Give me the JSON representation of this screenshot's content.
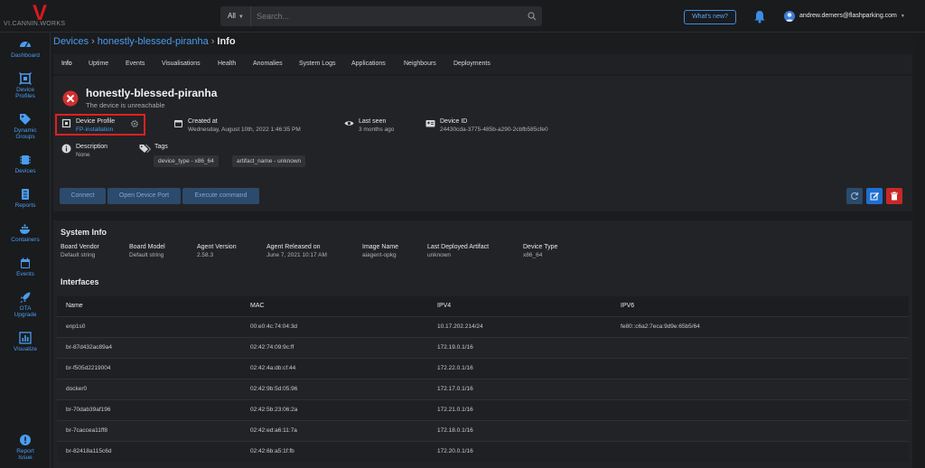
{
  "header": {
    "logo_mark": "V",
    "logo_text": "VI.CANNIN.WORKS",
    "search_scope": "All",
    "search_placeholder": "Search...",
    "whats_new": "What's new?",
    "user_email": "andrew.demers@flashparking.com"
  },
  "sidebar": {
    "items": [
      {
        "label": "Dashboard",
        "icon": "dashboard-icon"
      },
      {
        "label": "Device Profiles",
        "icon": "device-profile-icon"
      },
      {
        "label": "Dynamic Groups",
        "icon": "tags-icon"
      },
      {
        "label": "Devices",
        "icon": "chip-icon"
      },
      {
        "label": "Reports",
        "icon": "report-icon"
      },
      {
        "label": "Containers",
        "icon": "docker-icon"
      },
      {
        "label": "Events",
        "icon": "calendar-icon"
      },
      {
        "label": "OTA Upgrade",
        "icon": "rocket-icon"
      },
      {
        "label": "Visualize",
        "icon": "chart-icon"
      }
    ],
    "report_issue": "Report Issue"
  },
  "breadcrumb": {
    "root": "Devices",
    "device": "honestly-blessed-piranha",
    "current": "Info"
  },
  "tabs": [
    "Info",
    "Uptime",
    "Events",
    "Visualisations",
    "Health",
    "Anomalies",
    "System Logs",
    "Applications",
    "Neighbours",
    "Deployments"
  ],
  "device": {
    "name": "honestly-blessed-piranha",
    "status": "The device is unreachable",
    "profile_label": "Device Profile",
    "profile_value": "FP-installation",
    "created_label": "Created at",
    "created_value": "Wednesday, August 10th, 2022 1:46:35 PM",
    "lastseen_label": "Last seen",
    "lastseen_value": "3 months ago",
    "id_label": "Device ID",
    "id_value": "24430cda-3775-485b-a290-2cbfb585cfe0",
    "description_label": "Description",
    "description_value": "None",
    "tags_label": "Tags",
    "tags": [
      "device_type - x86_64",
      "artifact_name - unknown"
    ]
  },
  "actions": {
    "connect": "Connect",
    "open_port": "Open Device Port",
    "execute": "Execute command"
  },
  "system_info": {
    "title": "System Info",
    "fields": [
      {
        "label": "Board Vendor",
        "value": "Default string"
      },
      {
        "label": "Board Model",
        "value": "Default string"
      },
      {
        "label": "Agent Version",
        "value": "2.58.3"
      },
      {
        "label": "Agent Released on",
        "value": "June 7, 2021 10:17 AM"
      },
      {
        "label": "Image Name",
        "value": "aiagent-opkg"
      },
      {
        "label": "Last Deployed Artifact",
        "value": "unknown"
      },
      {
        "label": "Device Type",
        "value": "x86_64"
      }
    ]
  },
  "interfaces": {
    "title": "Interfaces",
    "columns": [
      "Name",
      "MAC",
      "IPV4",
      "IPV6"
    ],
    "rows": [
      [
        "enp1s0",
        "00:e0:4c:74:04:3d",
        "10.17.202.214/24",
        "fe80::c6a2:7eca:9d9e:65b5/64"
      ],
      [
        "br-87d432ac89a4",
        "02:42:74:09:9c:ff",
        "172.19.0.1/16",
        ""
      ],
      [
        "br-f505d2219004",
        "02:42:4a:db:cf:44",
        "172.22.0.1/16",
        ""
      ],
      [
        "docker0",
        "02:42:9b:5d:05:96",
        "172.17.0.1/16",
        ""
      ],
      [
        "br-70dab39af196",
        "02:42:5b:23:06:2a",
        "172.21.0.1/16",
        ""
      ],
      [
        "br-7caccea11ff8",
        "02:42:ed:a6:11:7a",
        "172.18.0.1/16",
        ""
      ],
      [
        "br-82418a115c6d",
        "02:42:6b:a5:1f:fb",
        "172.20.0.1/16",
        ""
      ]
    ]
  },
  "colors": {
    "accent": "#4a9cf0",
    "danger": "#d32f2f",
    "highlight": "#e02020"
  }
}
